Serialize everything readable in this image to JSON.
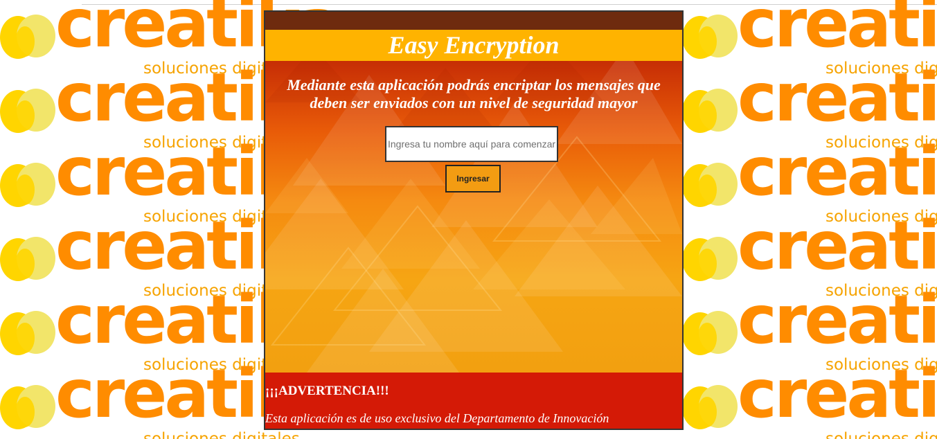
{
  "background": {
    "brand_word": "creatika",
    "brand_tagline": "soluciones digitales",
    "brand_color": "#ff8c00",
    "heart_colors": [
      "#ffd500",
      "#f2e56a"
    ]
  },
  "app": {
    "title": "Easy Encryption",
    "intro": "Mediante esta aplicación podrás encriptar los mensajes que deben ser enviados con un nivel de seguridad mayor",
    "name_input": {
      "value": "",
      "placeholder": "Ingresa tu nombre aquí para comenzar"
    },
    "enter_button": "Ingresar",
    "warning_title": "¡¡¡ADVERTENCIA!!!",
    "warning_text": "Esta aplicación es de uso exclusivo del Departamento de Innovación"
  },
  "colors": {
    "title_bar": "#ffb300",
    "footer": "#d41a06",
    "button": "#f39c12"
  }
}
